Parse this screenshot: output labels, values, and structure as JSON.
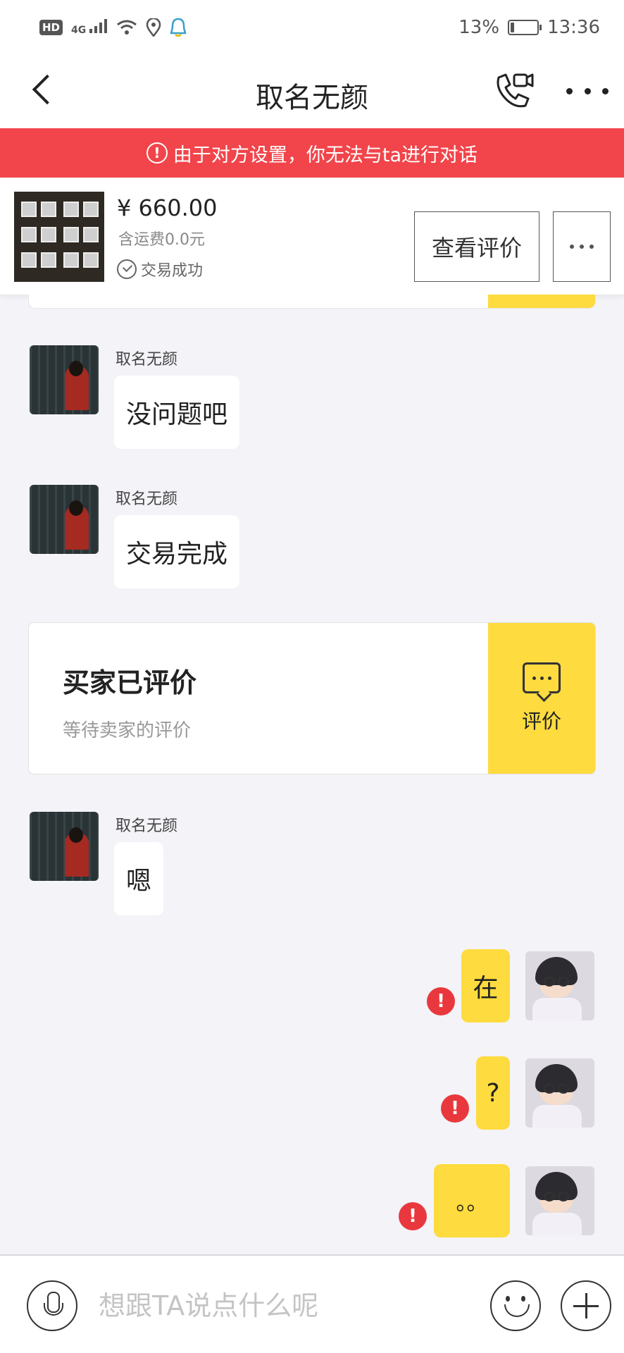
{
  "status_bar": {
    "network_badge": "HD",
    "signal_label": "4G",
    "battery_percent": "13%",
    "battery_level": 0.13,
    "time": "13:36",
    "icons": [
      "hd-icon",
      "signal-icon",
      "wifi-icon",
      "location-icon",
      "notification-icon",
      "battery-icon"
    ]
  },
  "header": {
    "title": "取名无颜",
    "icons": [
      "back-icon",
      "video-call-icon",
      "more-icon"
    ]
  },
  "banner": {
    "text": "由于对方设置，你无法与ta进行对话",
    "icon": "alert-circle-icon",
    "color": "#f1454b"
  },
  "product": {
    "price": "¥ 660.00",
    "shipping": "含运费0.0元",
    "status": "交易成功",
    "review_button": "查看评价",
    "more_icon": "more-icon"
  },
  "messages": [
    {
      "from": "other",
      "sender": "取名无颜",
      "text": "没问题吧"
    },
    {
      "from": "other",
      "sender": "取名无颜",
      "text": "交易完成"
    },
    {
      "type": "eval_card",
      "title": "买家已评价",
      "subtitle": "等待卖家的评价",
      "button": "评价"
    },
    {
      "from": "other",
      "sender": "取名无颜",
      "text": "嗯"
    },
    {
      "from": "me",
      "text": "在",
      "failed": true
    },
    {
      "from": "me",
      "text": "?",
      "failed": true
    },
    {
      "from": "me",
      "text": "。。",
      "failed": true
    }
  ],
  "error_badge": "!",
  "input_bar": {
    "placeholder": "想跟TA说点什么呢",
    "icons": [
      "microphone-icon",
      "emoji-icon",
      "plus-icon"
    ]
  },
  "colors": {
    "accent_yellow": "#fedb3e",
    "alert_red": "#f1454b",
    "error_red": "#e9383d",
    "background": "#f3f3f8"
  }
}
